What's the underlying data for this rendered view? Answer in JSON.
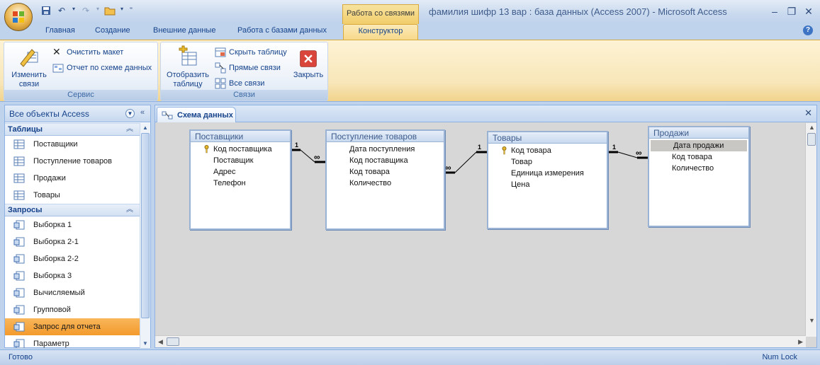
{
  "window": {
    "title": "фамилия шифр 13 вар : база данных (Access 2007)  -  Microsoft Access",
    "context_group": "Работа со связями"
  },
  "tabs": [
    "Главная",
    "Создание",
    "Внешние данные",
    "Работа с базами данных",
    "Конструктор"
  ],
  "ribbon": {
    "service": {
      "label": "Сервис",
      "edit_links": "Изменить связи",
      "clear_layout": "Очистить макет",
      "report": "Отчет по схеме данных"
    },
    "links": {
      "label": "Связи",
      "show_table": "Отобразить таблицу",
      "hide_table": "Скрыть таблицу",
      "direct_links": "Прямые связи",
      "all_links": "Все связи",
      "close": "Закрыть"
    }
  },
  "nav": {
    "header": "Все объекты Access",
    "sections": [
      {
        "title": "Таблицы",
        "items": [
          "Поставщики",
          "Поступление товаров",
          "Продажи",
          "Товары"
        ]
      },
      {
        "title": "Запросы",
        "items": [
          "Выборка 1",
          "Выборка 2-1",
          "Выборка 2-2",
          "Выборка 3",
          "Вычисляемый",
          "Групповой",
          "Запрос для отчета",
          "Параметр"
        ]
      }
    ],
    "selected": "Запрос для отчета"
  },
  "document": {
    "tab": "Схема данных"
  },
  "tables": [
    {
      "name": "Поставщики",
      "fields": [
        "Код поставщика",
        "Поставщик",
        "Адрес",
        "Телефон"
      ],
      "pk": "Код поставщика"
    },
    {
      "name": "Поступление товаров",
      "fields": [
        "Дата поступления",
        "Код поставщика",
        "Код товара",
        "Количество"
      ],
      "pk": ""
    },
    {
      "name": "Товары",
      "fields": [
        "Код товара",
        "Товар",
        "Единица измерения",
        "Цена"
      ],
      "pk": "Код товара"
    },
    {
      "name": "Продажи",
      "fields": [
        "Дата продажи",
        "Код товара",
        "Количество"
      ],
      "pk": "",
      "selected": "Дата продажи"
    }
  ],
  "relations": {
    "one": "1",
    "many": "∞"
  },
  "status": {
    "left": "Готово",
    "right": "Num Lock"
  }
}
